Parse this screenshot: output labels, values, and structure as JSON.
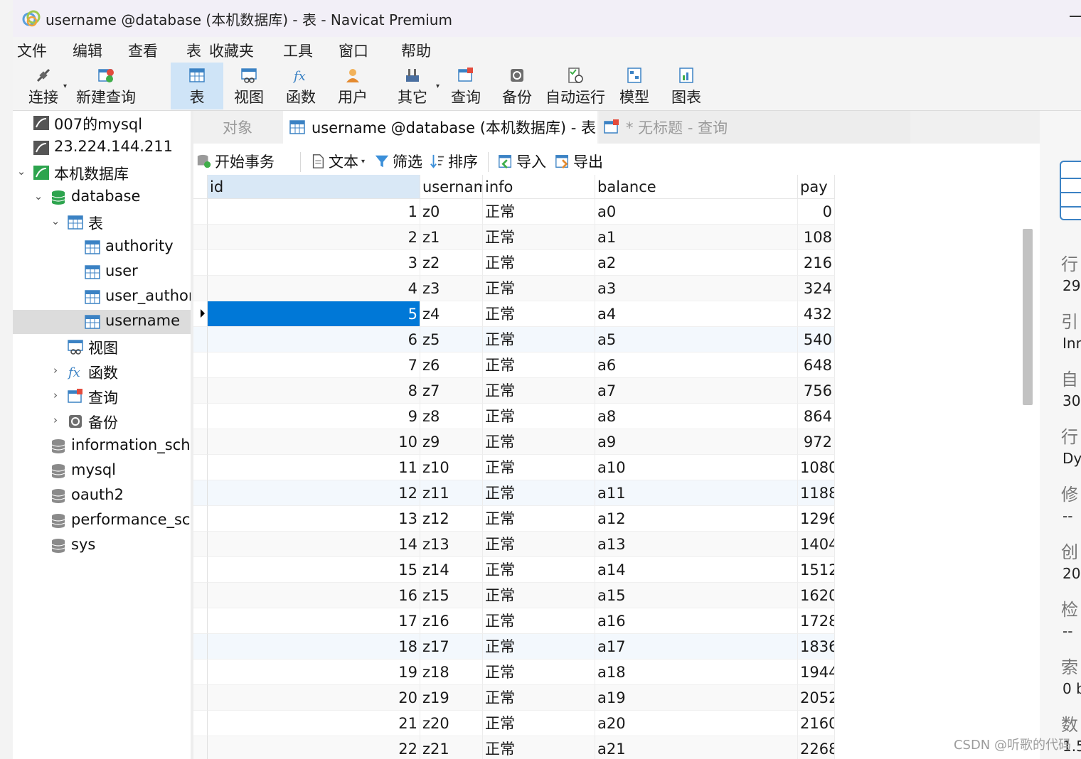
{
  "window": {
    "title": "username @database (本机数据库) - 表 - Navicat Premium"
  },
  "menu": [
    "文件",
    "编辑",
    "查看",
    "表",
    "收藏夹",
    "工具",
    "窗口",
    "帮助"
  ],
  "toolbar": {
    "connect": "连接",
    "new_query": "新建查询",
    "table": "表",
    "view": "视图",
    "function": "函数",
    "user": "用户",
    "other": "其它",
    "query": "查询",
    "backup": "备份",
    "automation": "自动运行",
    "model": "模型",
    "chart": "图表"
  },
  "nav": {
    "conn1": "007的mysql",
    "conn2": "23.224.144.211",
    "conn3": "本机数据库",
    "db": "database",
    "tables_group": "表",
    "tables": [
      "authority",
      "user",
      "user_author",
      "username"
    ],
    "views": "视图",
    "functions": "函数",
    "queries": "查询",
    "backups": "备份",
    "other_dbs": [
      "information_sche",
      "mysql",
      "oauth2",
      "performance_sch",
      "sys"
    ]
  },
  "tabs": {
    "objects": "对象",
    "current": "username @database (本机数据库) - 表",
    "query": "* 无标题 - 查询"
  },
  "actions": {
    "begin_tx": "开始事务",
    "text": "文本",
    "filter": "筛选",
    "sort": "排序",
    "import": "导入",
    "export": "导出"
  },
  "grid": {
    "columns": [
      "id",
      "usernam",
      "info",
      "balance",
      "pay"
    ],
    "rows": [
      [
        "1",
        "z0",
        "正常",
        "a0",
        "0"
      ],
      [
        "2",
        "z1",
        "正常",
        "a1",
        "108"
      ],
      [
        "3",
        "z2",
        "正常",
        "a2",
        "216"
      ],
      [
        "4",
        "z3",
        "正常",
        "a3",
        "324"
      ],
      [
        "5",
        "z4",
        "正常",
        "a4",
        "432"
      ],
      [
        "6",
        "z5",
        "正常",
        "a5",
        "540"
      ],
      [
        "7",
        "z6",
        "正常",
        "a6",
        "648"
      ],
      [
        "8",
        "z7",
        "正常",
        "a7",
        "756"
      ],
      [
        "9",
        "z8",
        "正常",
        "a8",
        "864"
      ],
      [
        "10",
        "z9",
        "正常",
        "a9",
        "972"
      ],
      [
        "11",
        "z10",
        "正常",
        "a10",
        "1080"
      ],
      [
        "12",
        "z11",
        "正常",
        "a11",
        "1188"
      ],
      [
        "13",
        "z12",
        "正常",
        "a12",
        "1296"
      ],
      [
        "14",
        "z13",
        "正常",
        "a13",
        "1404"
      ],
      [
        "15",
        "z14",
        "正常",
        "a14",
        "1512"
      ],
      [
        "16",
        "z15",
        "正常",
        "a15",
        "1620"
      ],
      [
        "17",
        "z16",
        "正常",
        "a16",
        "1728"
      ],
      [
        "18",
        "z17",
        "正常",
        "a17",
        "1836"
      ],
      [
        "19",
        "z18",
        "正常",
        "a18",
        "1944"
      ],
      [
        "20",
        "z19",
        "正常",
        "a19",
        "2052"
      ],
      [
        "21",
        "z20",
        "正常",
        "a20",
        "2160"
      ],
      [
        "22",
        "z21",
        "正常",
        "a21",
        "2268"
      ]
    ]
  },
  "info_panel": {
    "labels": [
      "行",
      "引",
      "自",
      "行",
      "修",
      "创",
      "检",
      "索",
      "数"
    ],
    "values": [
      "29,",
      "Inn",
      "30,",
      "Dy",
      "--",
      "20",
      "--",
      "0 b",
      "1.5"
    ]
  },
  "watermark": "CSDN @听歌的代码",
  "colors": {
    "selection": "#0078d7",
    "active_tool": "#cfe4f7",
    "header_selected": "#d9e8f6"
  }
}
